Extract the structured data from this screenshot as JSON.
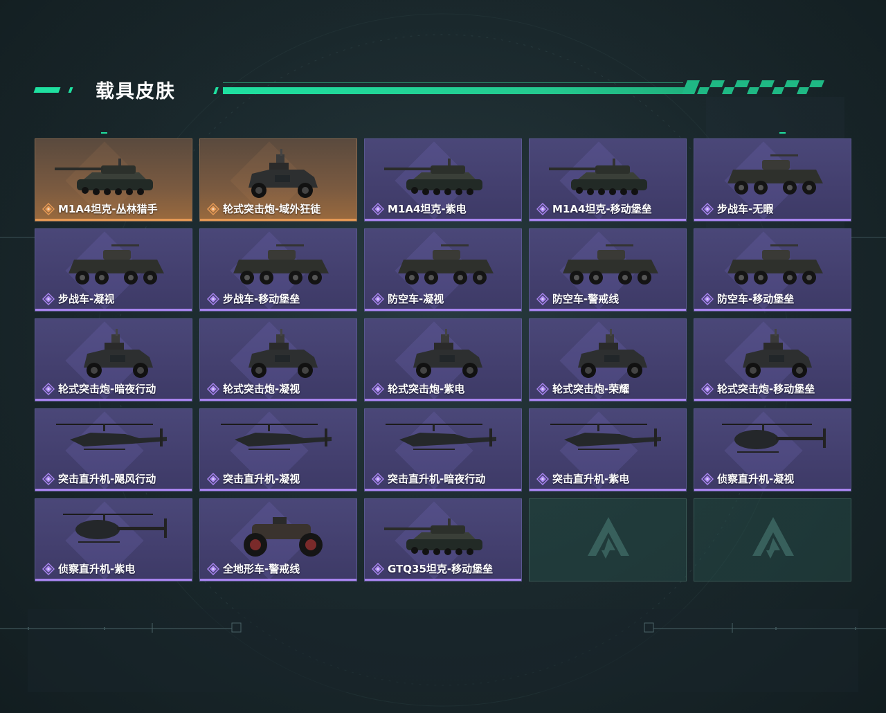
{
  "header": {
    "title": "载具皮肤"
  },
  "colors": {
    "accent": "#1fe0a0",
    "card_purple": "#433f6e",
    "card_orange": "#7a5a40",
    "rarity_purple": "#a985f0",
    "rarity_orange": "#e79a55"
  },
  "skins": [
    {
      "label": "M1A4坦克-丛林猎手",
      "rarity": "orange",
      "vehicle": "tank-icon"
    },
    {
      "label": "轮式突击炮-域外狂徒",
      "rarity": "orange",
      "vehicle": "armored-car-icon"
    },
    {
      "label": "M1A4坦克-紫电",
      "rarity": "purple",
      "vehicle": "tank-icon"
    },
    {
      "label": "M1A4坦克-移动堡垒",
      "rarity": "purple",
      "vehicle": "tank-icon"
    },
    {
      "label": "步战车-无暇",
      "rarity": "purple",
      "vehicle": "ifv-icon"
    },
    {
      "label": "步战车-凝视",
      "rarity": "purple",
      "vehicle": "ifv-icon"
    },
    {
      "label": "步战车-移动堡垒",
      "rarity": "purple",
      "vehicle": "ifv-icon"
    },
    {
      "label": "防空车-凝视",
      "rarity": "purple",
      "vehicle": "ifv-icon"
    },
    {
      "label": "防空车-警戒线",
      "rarity": "purple",
      "vehicle": "ifv-icon"
    },
    {
      "label": "防空车-移动堡垒",
      "rarity": "purple",
      "vehicle": "ifv-icon"
    },
    {
      "label": "轮式突击炮-暗夜行动",
      "rarity": "purple",
      "vehicle": "armored-car-icon"
    },
    {
      "label": "轮式突击炮-凝视",
      "rarity": "purple",
      "vehicle": "armored-car-icon"
    },
    {
      "label": "轮式突击炮-紫电",
      "rarity": "purple",
      "vehicle": "armored-car-icon"
    },
    {
      "label": "轮式突击炮-荣耀",
      "rarity": "purple",
      "vehicle": "armored-car-icon"
    },
    {
      "label": "轮式突击炮-移动堡垒",
      "rarity": "purple",
      "vehicle": "armored-car-icon"
    },
    {
      "label": "突击直升机-飓风行动",
      "rarity": "purple",
      "vehicle": "attack-helicopter-icon"
    },
    {
      "label": "突击直升机-凝视",
      "rarity": "purple",
      "vehicle": "attack-helicopter-icon"
    },
    {
      "label": "突击直升机-暗夜行动",
      "rarity": "purple",
      "vehicle": "attack-helicopter-icon"
    },
    {
      "label": "突击直升机-紫电",
      "rarity": "purple",
      "vehicle": "attack-helicopter-icon"
    },
    {
      "label": "侦察直升机-凝视",
      "rarity": "purple",
      "vehicle": "scout-helicopter-icon"
    },
    {
      "label": "侦察直升机-紫电",
      "rarity": "purple",
      "vehicle": "scout-helicopter-icon"
    },
    {
      "label": "全地形车-警戒线",
      "rarity": "purple",
      "vehicle": "atv-icon"
    },
    {
      "label": "GTQ35坦克-移动堡垒",
      "rarity": "purple",
      "vehicle": "tank-icon"
    }
  ],
  "empty_slots": 2
}
